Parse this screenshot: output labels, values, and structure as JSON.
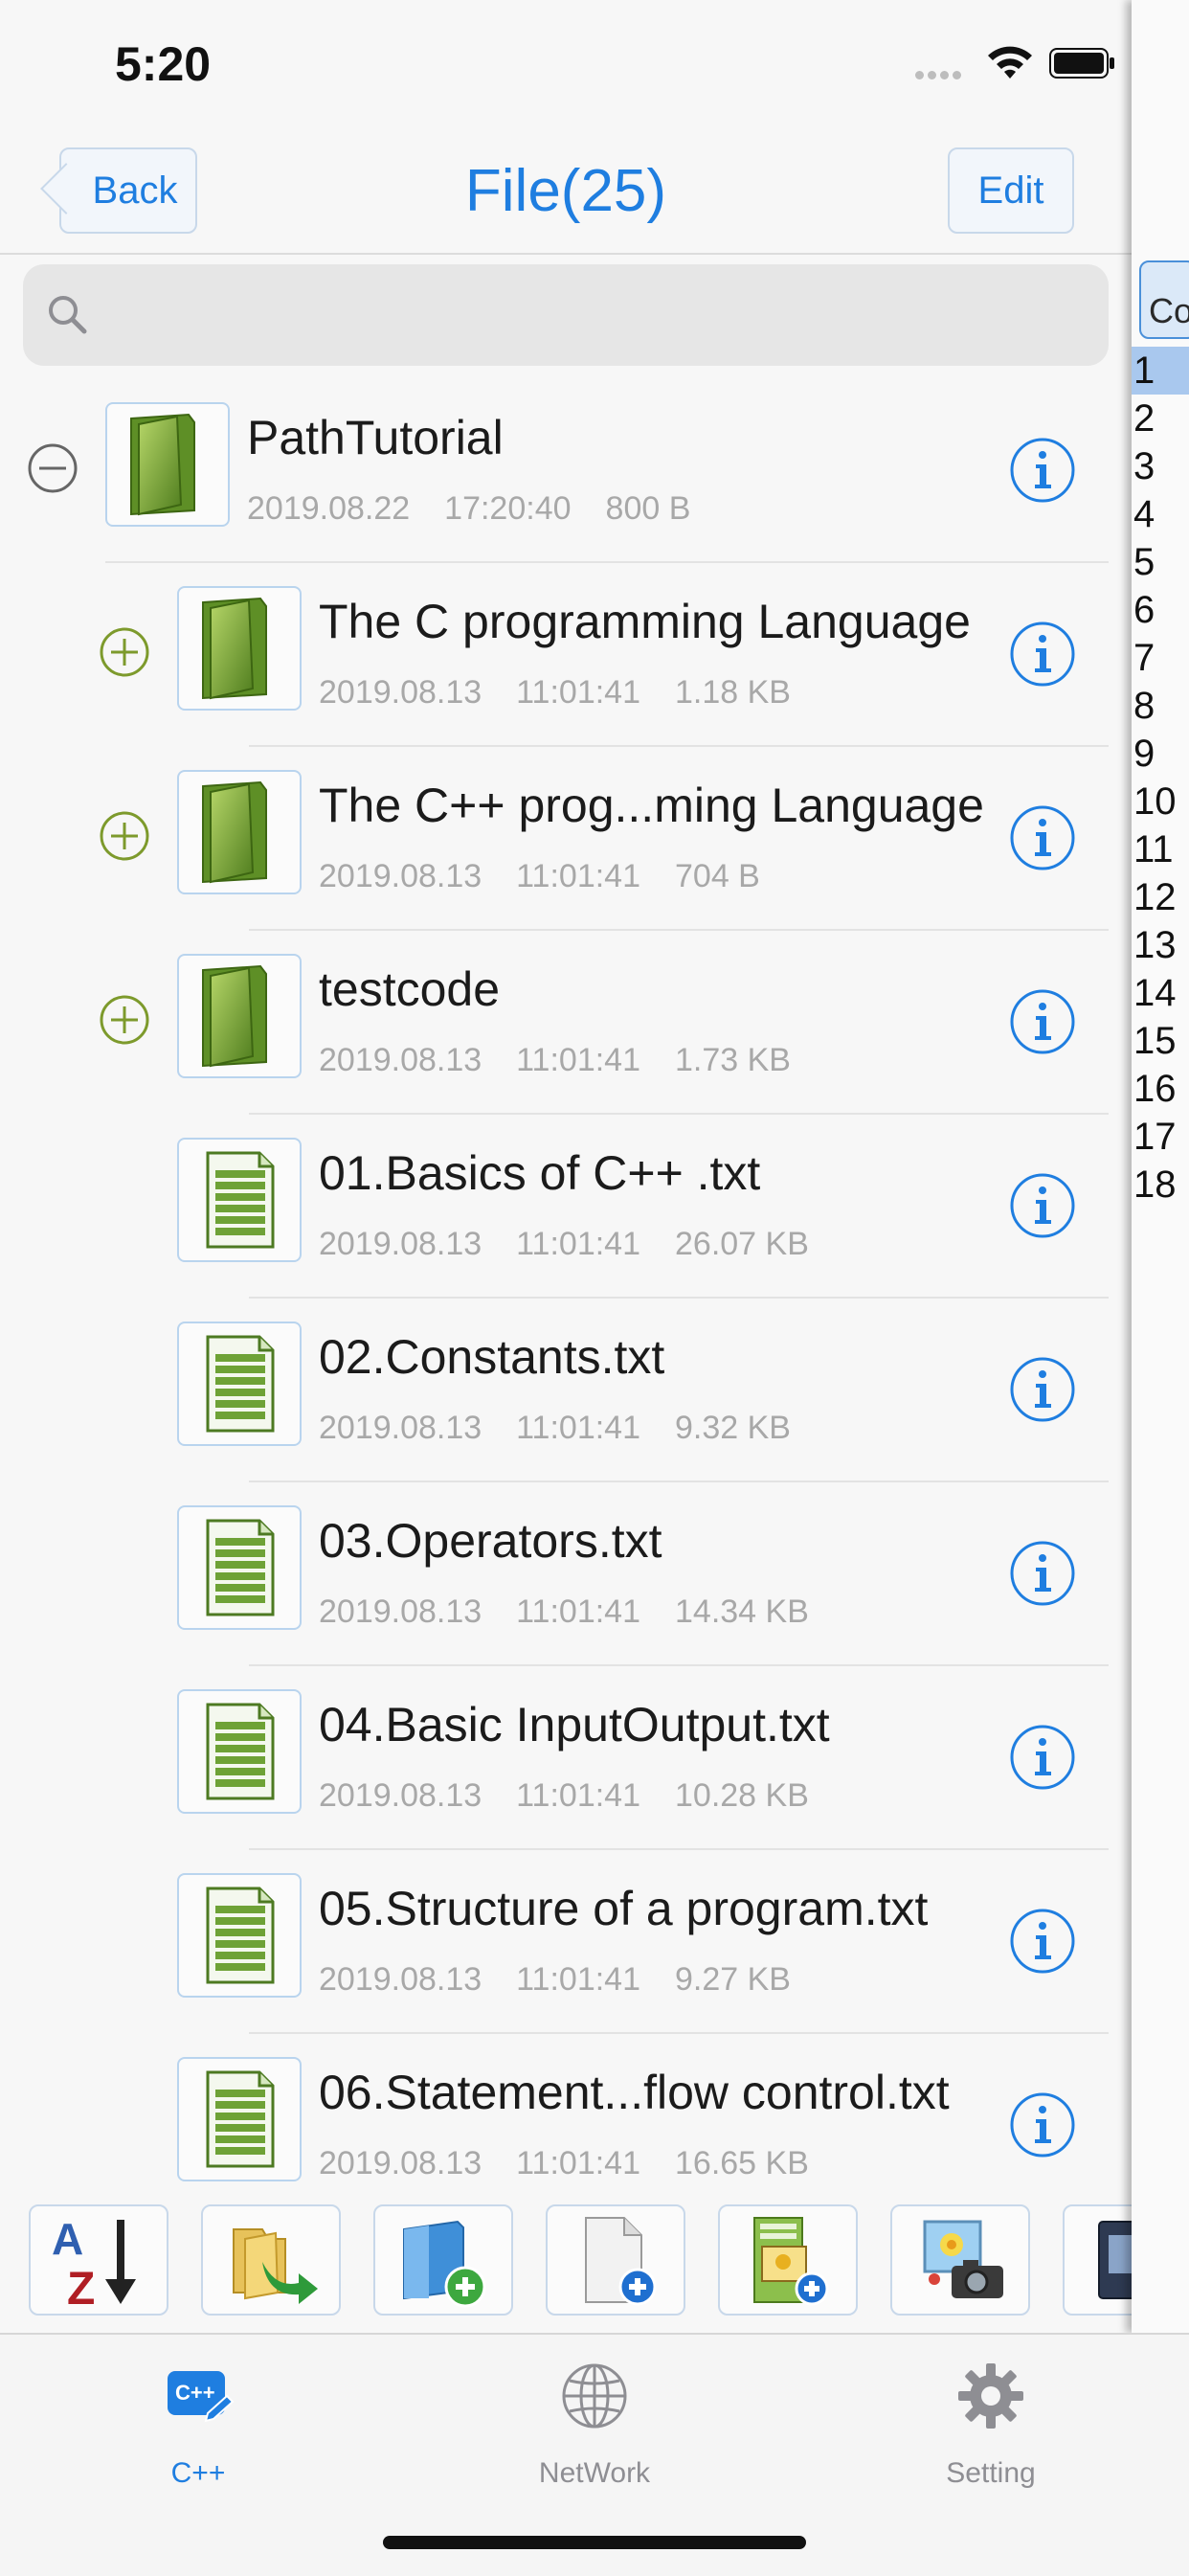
{
  "status": {
    "time": "5:20"
  },
  "nav": {
    "back": "Back",
    "title": "File(25)",
    "edit": "Edit"
  },
  "search": {
    "placeholder": ""
  },
  "rows": [
    {
      "name": "PathTutorial",
      "date": "2019.08.22",
      "time": "17:20:40",
      "size": "800 B",
      "type": "folder",
      "level": 0,
      "toggle": "collapse"
    },
    {
      "name": "The C programming Language",
      "date": "2019.08.13",
      "time": "11:01:41",
      "size": "1.18 KB",
      "type": "folder",
      "level": 1,
      "toggle": "expand"
    },
    {
      "name": "The C++ prog...ming Language",
      "date": "2019.08.13",
      "time": "11:01:41",
      "size": "704 B",
      "type": "folder",
      "level": 1,
      "toggle": "expand"
    },
    {
      "name": "testcode",
      "date": "2019.08.13",
      "time": "11:01:41",
      "size": "1.73 KB",
      "type": "folder",
      "level": 1,
      "toggle": "expand"
    },
    {
      "name": "01.Basics of C++ .txt",
      "date": "2019.08.13",
      "time": "11:01:41",
      "size": "26.07 KB",
      "type": "file",
      "level": 1
    },
    {
      "name": "02.Constants.txt",
      "date": "2019.08.13",
      "time": "11:01:41",
      "size": "9.32 KB",
      "type": "file",
      "level": 1
    },
    {
      "name": "03.Operators.txt",
      "date": "2019.08.13",
      "time": "11:01:41",
      "size": "14.34 KB",
      "type": "file",
      "level": 1
    },
    {
      "name": "04.Basic InputOutput.txt",
      "date": "2019.08.13",
      "time": "11:01:41",
      "size": "10.28 KB",
      "type": "file",
      "level": 1
    },
    {
      "name": "05.Structure of a program.txt",
      "date": "2019.08.13",
      "time": "11:01:41",
      "size": "9.27 KB",
      "type": "file",
      "level": 1
    },
    {
      "name": "06.Statement...flow control.txt",
      "date": "2019.08.13",
      "time": "11:01:41",
      "size": "16.65 KB",
      "type": "file",
      "level": 1
    }
  ],
  "toolbar": [
    "sort-az-icon",
    "move-folder-icon",
    "new-folder-icon",
    "new-file-icon",
    "add-image-file-icon",
    "camera-photo-icon",
    "book-icon"
  ],
  "index": {
    "header": "Co",
    "items": [
      "1",
      "2",
      "3",
      "4",
      "5",
      "6",
      "7",
      "8",
      "9",
      "10",
      "11",
      "12",
      "13",
      "14",
      "15",
      "16",
      "17",
      "18"
    ],
    "selected": "1"
  },
  "tabs": [
    {
      "label": "C++",
      "icon": "cpp-icon",
      "active": true
    },
    {
      "label": "NetWork",
      "icon": "globe-icon",
      "active": false
    },
    {
      "label": "Setting",
      "icon": "gear-icon",
      "active": false
    }
  ],
  "colors": {
    "accent": "#1f7ee0",
    "folder": "#7aa83a",
    "inactive": "#8e8e93"
  }
}
